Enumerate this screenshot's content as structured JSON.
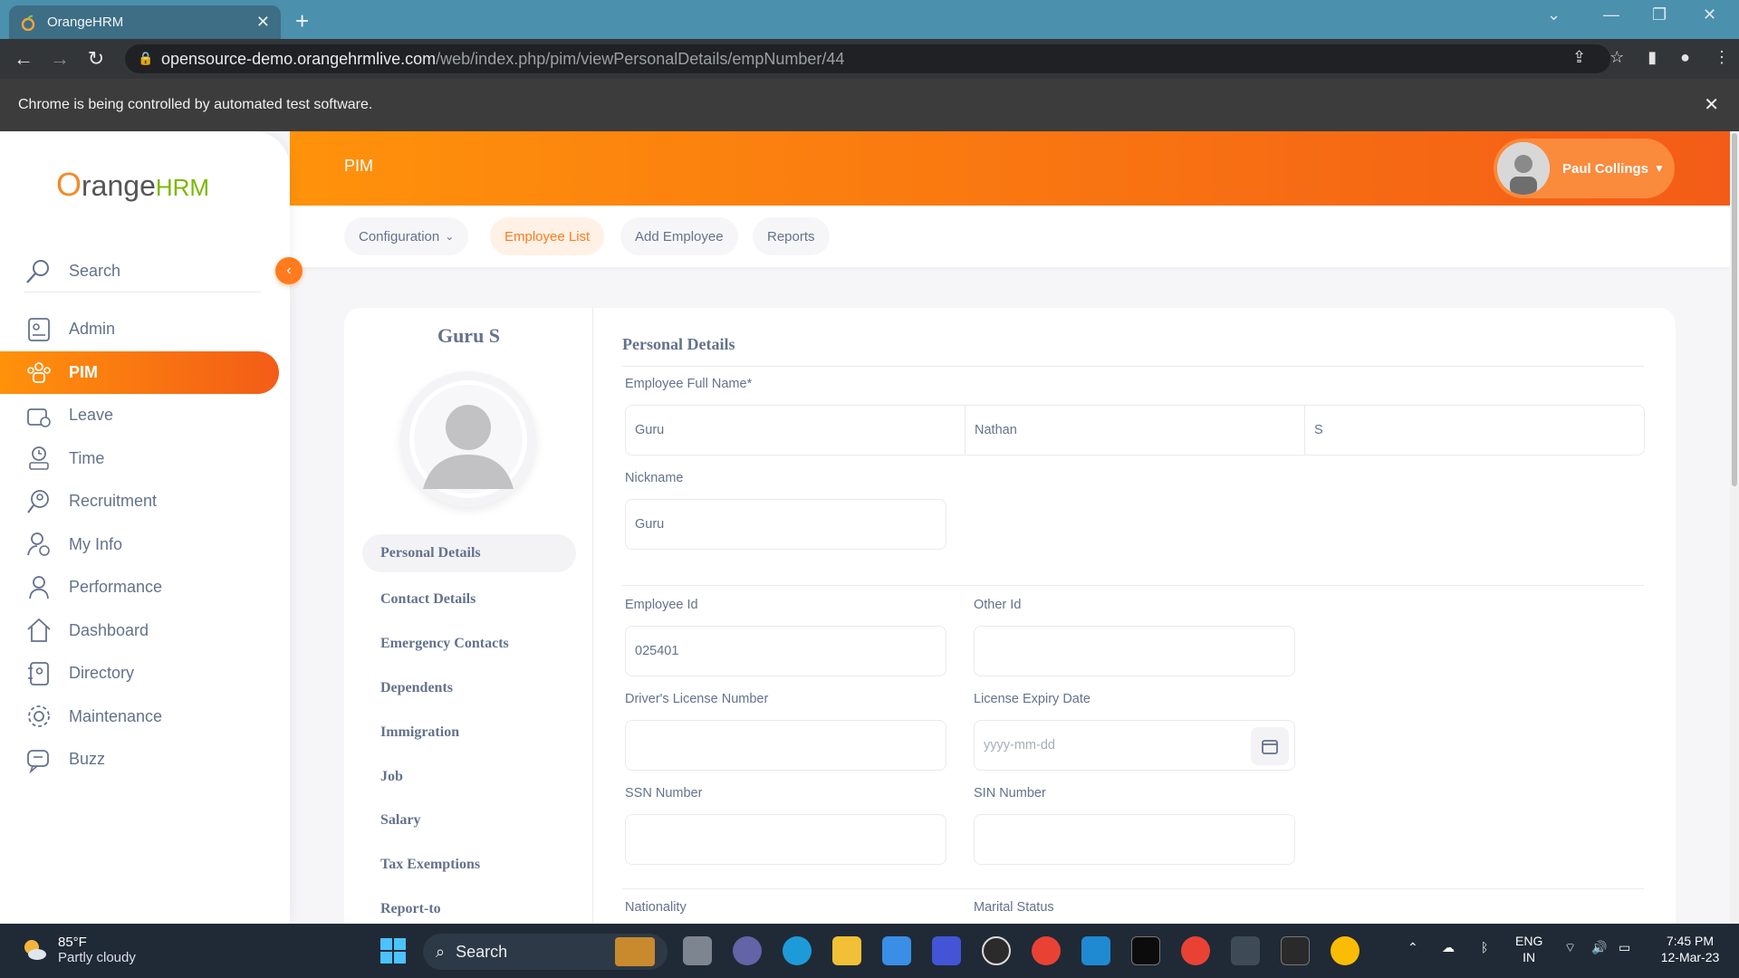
{
  "browser": {
    "tab_title": "OrangeHRM",
    "url_host": "opensource-demo.orangehrmlive.com",
    "url_path": "/web/index.php/pim/viewPersonalDetails/empNumber/44",
    "infobar_text": "Chrome is being controlled by automated test software."
  },
  "app": {
    "logo_o": "O",
    "logo_range": "range",
    "logo_hrm": "HRM",
    "header_title": "PIM",
    "user_name": "Paul Collings",
    "accent_color": "#ff7b1d"
  },
  "sidebar": {
    "search_label": "Search",
    "items": [
      {
        "label": "Admin"
      },
      {
        "label": "PIM"
      },
      {
        "label": "Leave"
      },
      {
        "label": "Time"
      },
      {
        "label": "Recruitment"
      },
      {
        "label": "My Info"
      },
      {
        "label": "Performance"
      },
      {
        "label": "Dashboard"
      },
      {
        "label": "Directory"
      },
      {
        "label": "Maintenance"
      },
      {
        "label": "Buzz"
      }
    ]
  },
  "subnav": {
    "configuration": "Configuration",
    "employee_list": "Employee List",
    "add_employee": "Add Employee",
    "reports": "Reports"
  },
  "employee": {
    "name": "Guru S",
    "tabs": [
      "Personal Details",
      "Contact Details",
      "Emergency Contacts",
      "Dependents",
      "Immigration",
      "Job",
      "Salary",
      "Tax Exemptions",
      "Report-to"
    ]
  },
  "form": {
    "section_title": "Personal Details",
    "full_name_label": "Employee Full Name*",
    "first_name": "Guru",
    "middle_name": "Nathan",
    "last_name": "S",
    "nickname_label": "Nickname",
    "nickname": "Guru",
    "employee_id_label": "Employee Id",
    "employee_id": "025401",
    "other_id_label": "Other Id",
    "other_id": "",
    "license_label": "Driver's License Number",
    "license": "",
    "license_expiry_label": "License Expiry Date",
    "license_expiry_placeholder": "yyyy-mm-dd",
    "ssn_label": "SSN Number",
    "ssn": "",
    "sin_label": "SIN Number",
    "sin": "",
    "nationality_label": "Nationality",
    "marital_label": "Marital Status"
  },
  "taskbar": {
    "temp": "85°F",
    "weather": "Partly cloudy",
    "search_label": "Search",
    "lang1": "ENG",
    "lang2": "IN",
    "time": "7:45 PM",
    "date": "12-Mar-23"
  }
}
